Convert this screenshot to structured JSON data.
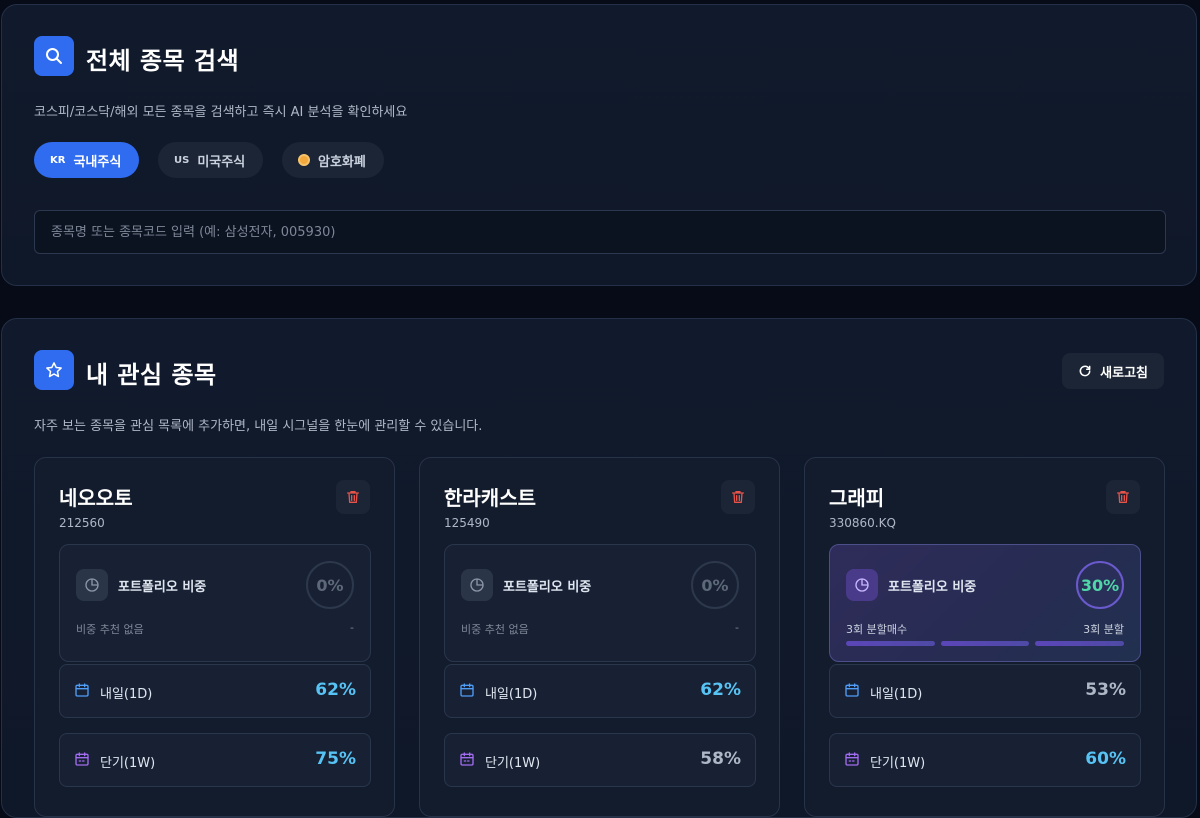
{
  "search": {
    "title": "전체 종목 검색",
    "description": "코스피/코스닥/해외 모든 종목을 검색하고 즉시 AI 분석을 확인하세요",
    "tabs": [
      {
        "flag": "KR",
        "label": "국내주식",
        "active": true
      },
      {
        "flag": "US",
        "label": "미국주식",
        "active": false
      },
      {
        "flag": "coin-icon",
        "label": "암호화폐",
        "active": false
      }
    ],
    "placeholder": "종목명 또는 종목코드 입력 (예: 삼성전자, 005930)"
  },
  "watchlist": {
    "title": "내 관심 종목",
    "refresh_label": "새로고침",
    "description": "자주 보는 종목을 관심 목록에 추가하면, 내일 시그널을 한눈에 관리할 수 있습니다.",
    "portfolio_label": "포트폴리오 비중",
    "cards": [
      {
        "name": "네오오토",
        "code": "212560",
        "weight": "0%",
        "note": "비중 추천 없음",
        "note_right": "-",
        "metrics": [
          {
            "label": "내일(1D)",
            "value": "62%"
          },
          {
            "label": "단기(1W)",
            "value": "75%"
          }
        ]
      },
      {
        "name": "한라캐스트",
        "code": "125490",
        "weight": "0%",
        "note": "비중 추천 없음",
        "note_right": "-",
        "metrics": [
          {
            "label": "내일(1D)",
            "value": "62%"
          },
          {
            "label": "단기(1W)",
            "value": "58%"
          }
        ]
      },
      {
        "name": "그래피",
        "code": "330860.KQ",
        "weight": "30%",
        "note": "3회 분할매수",
        "note_right": "3회 분할",
        "metrics": [
          {
            "label": "내일(1D)",
            "value": "53%"
          },
          {
            "label": "단기(1W)",
            "value": "60%"
          }
        ]
      }
    ]
  },
  "colors": {
    "accent": "#2f6cf0",
    "metric_high": "#57c3f5",
    "metric_neutral": "#aeb7c6",
    "delete": "#e5534b",
    "weight_positive": "#4fd7a8"
  }
}
